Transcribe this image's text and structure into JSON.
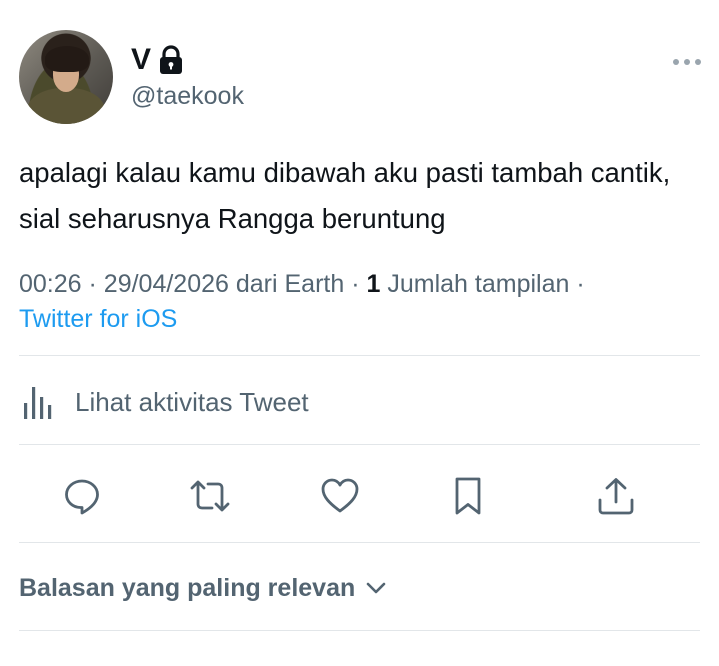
{
  "user": {
    "display_name": "V",
    "handle": "@taekook"
  },
  "tweet": {
    "text": "apalagi kalau kamu dibawah aku pasti tambah cantik, sial seharusnya Rangga beruntung"
  },
  "meta": {
    "time": "00:26",
    "separator": "·",
    "date": "29/04/2026",
    "from_text": "dari Earth",
    "views_count": "1",
    "views_label": "Jumlah tampilan",
    "source": "Twitter for iOS"
  },
  "activity": {
    "label": "Lihat aktivitas Tweet"
  },
  "replies_sort": {
    "label": "Balasan yang paling relevan"
  },
  "icons": {
    "lock": "lock-icon",
    "more": "more-icon",
    "activity": "bar-chart-icon",
    "reply": "reply-icon",
    "retweet": "retweet-icon",
    "like": "heart-icon",
    "bookmark": "bookmark-icon",
    "share": "share-icon",
    "chevron": "chevron-down-icon"
  },
  "colors": {
    "text": "#0f1419",
    "secondary": "#536471",
    "link": "#1d9bf0",
    "divider": "#e2e6e9"
  }
}
